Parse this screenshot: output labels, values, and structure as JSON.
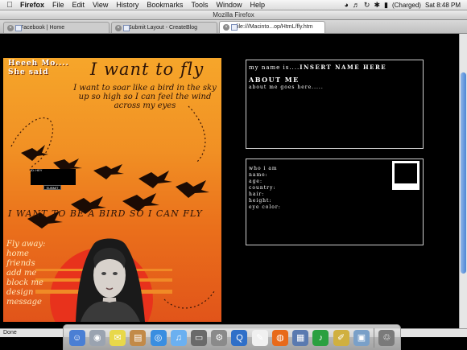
{
  "menubar": {
    "apple_icon": "apple-icon",
    "items": [
      "Firefox",
      "File",
      "Edit",
      "View",
      "History",
      "Bookmarks",
      "Tools",
      "Window",
      "Help"
    ],
    "battery": "(Charged)",
    "clock": "Sat 8:48 PM"
  },
  "window": {
    "title": "Mozilla Firefox"
  },
  "tabs": [
    {
      "label": "Facebook | Home",
      "active": false
    },
    {
      "label": "Submit Layout - CreateBlog",
      "active": false
    },
    {
      "label": "file:///Macinto...op/HtmL/fly.htm",
      "active": true
    }
  ],
  "artwork": {
    "heading_small": "Heeeh Mo.... She said",
    "heading_big": "I want to fly",
    "poem": "I want to soar like a bird in the sky up so high so I can feel the wind across my eyes",
    "login_label": "ID: HEY",
    "login_button": "SUBMIT",
    "bird_line": "I WANT TO BE A BIRD SO I CAN FLY",
    "fly_links": [
      "Fly away:",
      "home",
      "friends",
      "add me",
      "block me",
      "design",
      "message"
    ]
  },
  "profile_panel": {
    "name_prefix": "my name is....",
    "name_value": "INSERT NAME HERE",
    "about_title": "ABOUT ME",
    "about_body": "about me goes here....."
  },
  "info_panel": {
    "rows": [
      "who i am",
      "name:",
      "age:",
      "country:",
      "hair:",
      "height:",
      "eye color:"
    ]
  },
  "statusbar": {
    "text": "Done"
  },
  "dock": {
    "icons": [
      "finder-icon",
      "ichat-icon",
      "mail-icon",
      "address-book-icon",
      "safari-icon",
      "itunes-icon",
      "preview-icon",
      "system-preferences-icon",
      "quicktime-icon",
      "textedit-icon",
      "firefox-icon",
      "network-icon",
      "limewire-icon",
      "pencil-icon",
      "iphoto-icon",
      "trash-icon"
    ],
    "colors": [
      "#4a7fd4",
      "#9aa3b0",
      "#e8d84a",
      "#c28a48",
      "#3a8ee0",
      "#6bb0f0",
      "#6a6a6a",
      "#8a8a8a",
      "#2f6fc8",
      "#f0f0f0",
      "#e86a1a",
      "#5a7ab0",
      "#2aa040",
      "#d0b040",
      "#7aa0c8",
      "#7a7a7a"
    ]
  }
}
